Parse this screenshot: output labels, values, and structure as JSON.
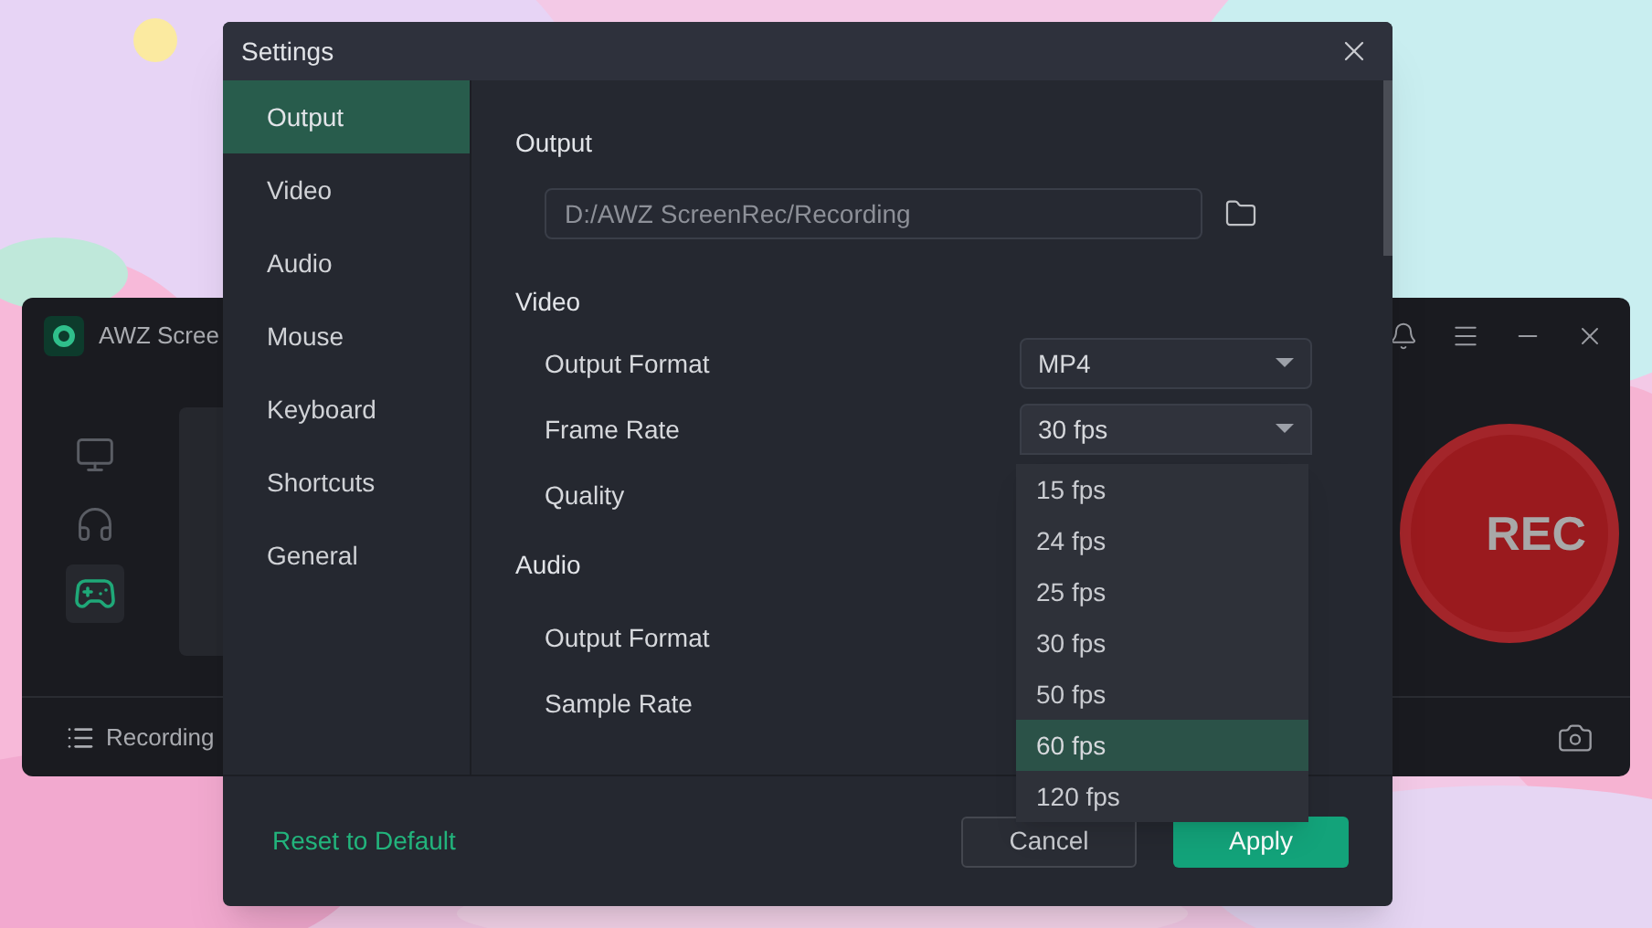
{
  "background_app": {
    "title": "AWZ Scree",
    "nav": [
      {
        "kind": "monitor",
        "selected": false
      },
      {
        "kind": "headphones",
        "selected": false
      },
      {
        "kind": "gamepad",
        "selected": true
      }
    ],
    "bottom_tab": "Recording",
    "rec_button": "REC"
  },
  "settings": {
    "title": "Settings",
    "sidebar": [
      {
        "label": "Output",
        "selected": true
      },
      {
        "label": "Video",
        "selected": false
      },
      {
        "label": "Audio",
        "selected": false
      },
      {
        "label": "Mouse",
        "selected": false
      },
      {
        "label": "Keyboard",
        "selected": false
      },
      {
        "label": "Shortcuts",
        "selected": false
      },
      {
        "label": "General",
        "selected": false
      }
    ],
    "output": {
      "heading": "Output",
      "path": "D:/AWZ ScreenRec/Recording"
    },
    "video": {
      "heading": "Video",
      "output_format": {
        "label": "Output Format",
        "value": "MP4"
      },
      "frame_rate": {
        "label": "Frame Rate",
        "value": "30 fps",
        "expanded": true
      },
      "quality": {
        "label": "Quality"
      }
    },
    "frame_rate_options": [
      {
        "label": "15 fps",
        "selected": false
      },
      {
        "label": "24 fps",
        "selected": false
      },
      {
        "label": "25 fps",
        "selected": false
      },
      {
        "label": "30 fps",
        "selected": false
      },
      {
        "label": "50 fps",
        "selected": false
      },
      {
        "label": "60 fps",
        "selected": true
      },
      {
        "label": "120 fps",
        "selected": false
      }
    ],
    "audio": {
      "heading": "Audio",
      "output_format": {
        "label": "Output Format"
      },
      "sample_rate": {
        "label": "Sample Rate"
      }
    },
    "reset_link": "Reset to Default",
    "buttons": [
      {
        "kind": "secondary",
        "label": "Cancel"
      },
      {
        "kind": "primary",
        "label": "Apply"
      }
    ]
  }
}
